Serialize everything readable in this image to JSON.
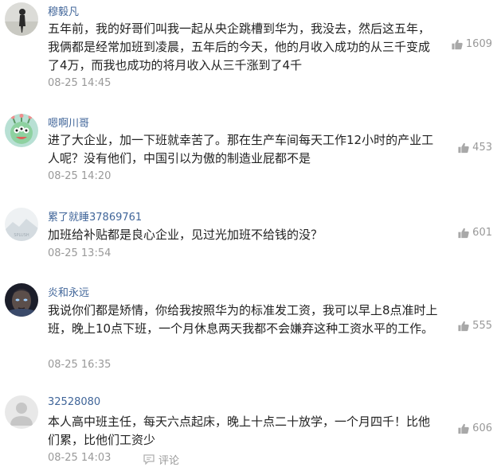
{
  "comments": [
    {
      "username": "穆毅凡",
      "text": "五年前，我的好哥们叫我一起从央企跳槽到华为，我没去，然后这五年，我俩都是经常加班到凌晨，五年后的今天，他的月收入成功的从三千变成了4万，而我也成功的将月收入从三千涨到了4千",
      "time": "08-25 14:45",
      "likes": "1609",
      "avatar_icon": "silhouette-avatar-icon"
    },
    {
      "username": "嗯啊川哥",
      "text": "进了大企业，加一下班就幸苦了。那在生产车间每天工作12小时的产业工人呢？没有他们，中国引以为傲的制造业屁都不是",
      "time": "08-25 14:20",
      "likes": "453",
      "avatar_icon": "cartoon-monster-avatar-icon"
    },
    {
      "username": "累了就睡37869761",
      "text": "加班给补贴都是良心企业，见过光加班不给钱的没？",
      "time": "08-25 13:54",
      "likes": "601",
      "avatar_icon": "landscape-avatar-icon"
    },
    {
      "username": "炎和永远",
      "text": "我说你们都是矫情，你给我按照华为的标准发工资，我可以早上8点准时上班，晚上10点下班，一个月休息两天我都不会嫌弃这种工资水平的工作。",
      "time": "08-25 16:35",
      "likes": "555",
      "avatar_icon": "character-portrait-avatar-icon"
    },
    {
      "username": "32528080",
      "text": "本人高中班主任，每天六点起床，晚上十点二十放学，一个月四千！比他们累，比他们工资少",
      "time": "08-25 14:03",
      "likes": "606",
      "reply_label": "评论",
      "avatar_icon": "default-user-avatar-icon"
    }
  ],
  "colors": {
    "username": "#406599",
    "text": "#222222",
    "meta": "#999999"
  }
}
